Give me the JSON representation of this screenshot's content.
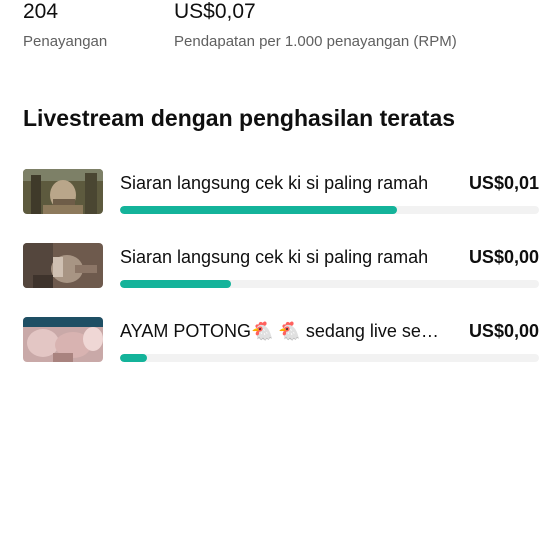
{
  "stats": {
    "views_value": "204",
    "views_label": "Penayangan",
    "rpm_value": "US$0,07",
    "rpm_label": "Pendapatan per 1.000 penayangan (RPM)"
  },
  "section": {
    "title": "Livestream dengan penghasilan teratas"
  },
  "colors": {
    "accent": "#14b39a",
    "track": "#f2f2f2",
    "secondary_text": "#606060"
  },
  "livestreams": [
    {
      "title": "Siaran langsung cek ki si paling ramah",
      "amount": "US$0,01",
      "progress": 0.66
    },
    {
      "title": "Siaran langsung cek ki si paling ramah",
      "amount": "US$0,00",
      "progress": 0.265
    },
    {
      "title": "AYAM POTONG🐔 🐔 sedang live sekarang",
      "amount": "US$0,00",
      "progress": 0.065
    }
  ]
}
